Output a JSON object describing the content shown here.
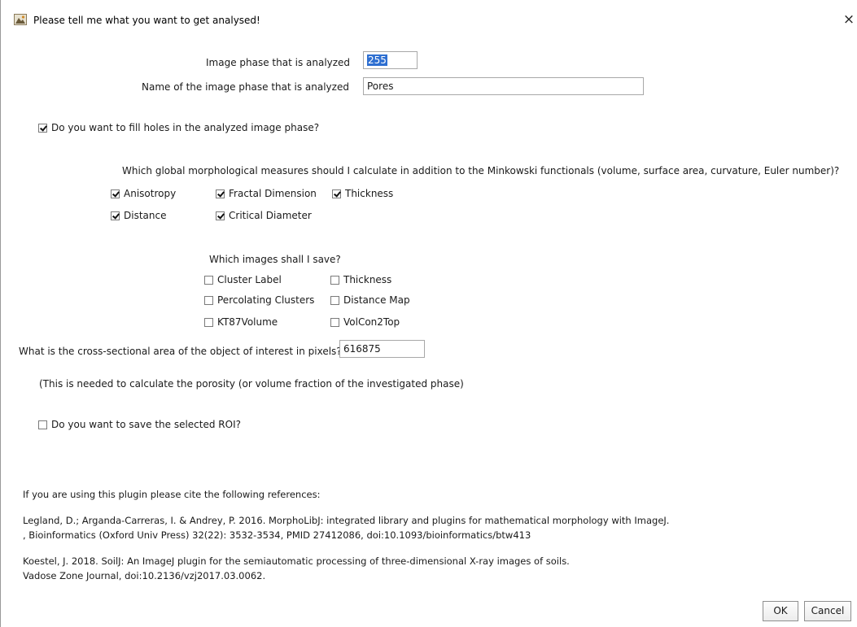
{
  "window": {
    "title": "Please tell me what you want to get analysed!",
    "close_glyph": "×"
  },
  "phase": {
    "label": "Image phase that is analyzed",
    "value": "255",
    "name_label": "Name of the image phase that is analyzed",
    "name_value": "Pores"
  },
  "fill_holes": {
    "label": "Do you want to fill holes in the analyzed image phase?",
    "checked": true
  },
  "measures": {
    "prompt": "Which global morphological measures should I calculate in addition to the Minkowski functionals (volume, surface area, curvature, Euler number)?",
    "items": [
      {
        "label": "Anisotropy",
        "checked": true
      },
      {
        "label": "Fractal Dimension",
        "checked": true
      },
      {
        "label": "Thickness",
        "checked": true
      },
      {
        "label": "Distance",
        "checked": true
      },
      {
        "label": "Critical Diameter",
        "checked": true
      }
    ]
  },
  "save_images": {
    "prompt": "Which images shall I save?",
    "items": [
      {
        "label": "Cluster Label",
        "checked": false
      },
      {
        "label": "Thickness",
        "checked": false
      },
      {
        "label": "Percolating Clusters",
        "checked": false
      },
      {
        "label": "Distance Map",
        "checked": false
      },
      {
        "label": "KT87Volume",
        "checked": false
      },
      {
        "label": "VolCon2Top",
        "checked": false
      }
    ]
  },
  "cross_section": {
    "label": "What is the cross-sectional area of the object of interest in pixels?",
    "value": "616875",
    "note": "(This is needed to calculate the porosity (or volume fraction of the investigated phase)"
  },
  "save_roi": {
    "label": "Do you want to save the selected ROI?",
    "checked": false
  },
  "references": {
    "intro": "If you are using this plugin please cite the following references:",
    "ref1_line1": "Legland, D.; Arganda-Carreras, I. & Andrey, P. 2016. MorphoLibJ: integrated library and plugins for mathematical morphology with ImageJ.",
    "ref1_line2": ", Bioinformatics (Oxford Univ Press) 32(22): 3532-3534, PMID 27412086, doi:10.1093/bioinformatics/btw413",
    "ref2_line1": "Koestel, J. 2018. SoilJ: An ImageJ plugin for the semiautomatic processing of three-dimensional X-ray images of soils.",
    "ref2_line2": " Vadose Zone Journal, doi:10.2136/vzj2017.03.0062."
  },
  "buttons": {
    "ok": "OK",
    "cancel": "Cancel"
  }
}
